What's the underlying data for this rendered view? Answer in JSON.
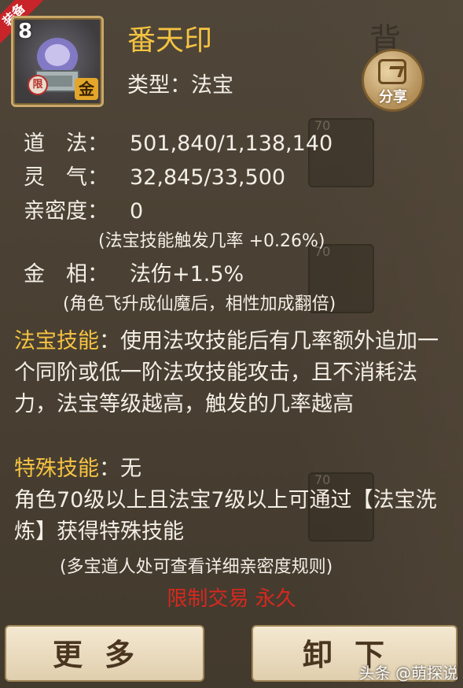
{
  "corner_badge": "装备",
  "item": {
    "level": "8",
    "name": "番天印",
    "type_line": "类型：法宝",
    "grade": "金",
    "seal": "限"
  },
  "share": {
    "label": "分享"
  },
  "background": {
    "tab_text": "背 包",
    "slot_levels": [
      "70",
      "70",
      "70"
    ]
  },
  "stats": [
    {
      "label": "道　法：",
      "value": "501,840/1,138,140"
    },
    {
      "label": "灵　气：",
      "value": "32,845/33,500"
    },
    {
      "label": "亲密度：",
      "value": "0"
    }
  ],
  "intimacy_note": "(法宝技能触发几率 +0.26%)",
  "gold_stat": {
    "label": "金　相：",
    "value": "法伤+1.5%"
  },
  "gold_note": "(角色飞升成仙魔后，相性加成翻倍)",
  "skill": {
    "title": "法宝技能",
    "text": "：使用法攻技能后有几率额外追加一个同阶或低一阶法攻技能攻击，且不消耗法力，法宝等级越高，触发的几率越高"
  },
  "special": {
    "title": "特殊技能",
    "value": "：无",
    "text": "角色70级以上且法宝7级以上可通过【法宝洗炼】获得特殊技能",
    "note": "(多宝道人处可查看详细亲密度规则)"
  },
  "restriction": "限制交易 永久",
  "buttons": {
    "more": "更多",
    "unequip": "卸下"
  },
  "watermark": "头条 @萌探说"
}
